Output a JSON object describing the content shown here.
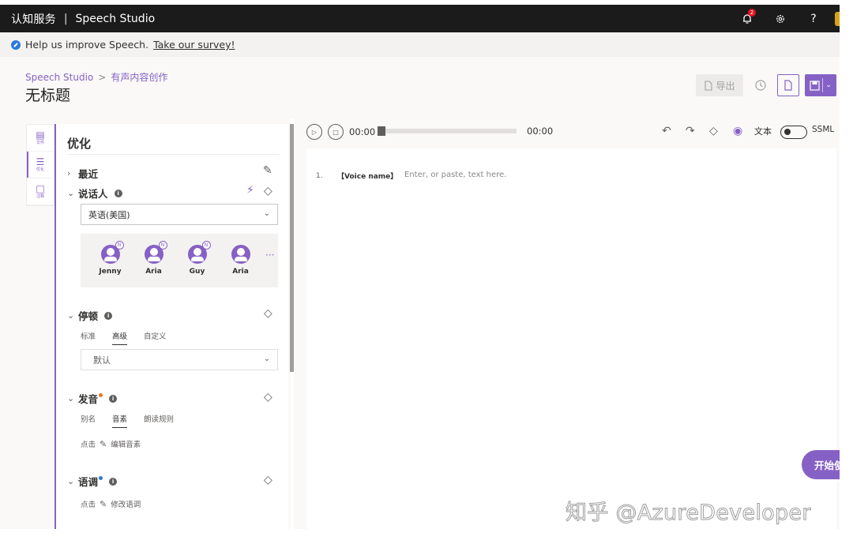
{
  "header": {
    "brand": "认知服务",
    "separator": "|",
    "product": "Speech Studio",
    "notification_count": "2",
    "settings_icon": "gear-icon",
    "help_label": "?"
  },
  "banner": {
    "text": "Help us improve Speech.",
    "link": "Take our survey!"
  },
  "page": {
    "breadcrumb_root": "Speech Studio",
    "breadcrumb_sep": ">",
    "breadcrumb_current": "有声内容创作",
    "title": "无标题",
    "export_label": "导出"
  },
  "rail": {
    "items": [
      {
        "label": "文件",
        "icon": "file-icon"
      },
      {
        "label": "优化",
        "icon": "sliders-icon"
      },
      {
        "label": "注释",
        "icon": "comment-icon"
      }
    ]
  },
  "panel": {
    "title": "优化",
    "recent": "最近",
    "speaker": {
      "label": "说话人",
      "info": "i",
      "language": "英语(美国)",
      "voices": [
        {
          "name": "Jenny",
          "badge": "N"
        },
        {
          "name": "Aria",
          "badge": "N"
        },
        {
          "name": "Guy",
          "badge": "N"
        },
        {
          "name": "Aria",
          "badge": ""
        }
      ],
      "more": "···"
    },
    "pause": {
      "label": "停顿",
      "info": "i",
      "tabs": [
        "标准",
        "高级",
        "自定义"
      ],
      "selected_tab": "高级",
      "value": "默认"
    },
    "pronunciation": {
      "label": "发音",
      "info": "i",
      "dot_color": "#e8792b",
      "tabs": [
        "别名",
        "音素",
        "朗读规则"
      ],
      "selected_tab": "音素",
      "hint_prefix": "点击",
      "hint_action": "编辑音素"
    },
    "intonation": {
      "label": "语调",
      "info": "i",
      "dot_color": "#2b78d8",
      "hint_prefix": "点击",
      "hint_action": "修改语调"
    }
  },
  "player": {
    "current_time": "00:00",
    "total_time": "00:00",
    "progress": 0
  },
  "editor": {
    "text_mode": "文本",
    "ssml_mode": "SSML",
    "line_number": "1.",
    "voice_tag": "【Voice name】",
    "placeholder": "Enter, or paste, text here."
  },
  "fab": {
    "label": "开始使"
  },
  "watermark": "知乎 @AzureDeveloper",
  "colors": {
    "accent": "#8661c5",
    "header_bg": "#1b1b1b",
    "badge": "#e81123"
  }
}
